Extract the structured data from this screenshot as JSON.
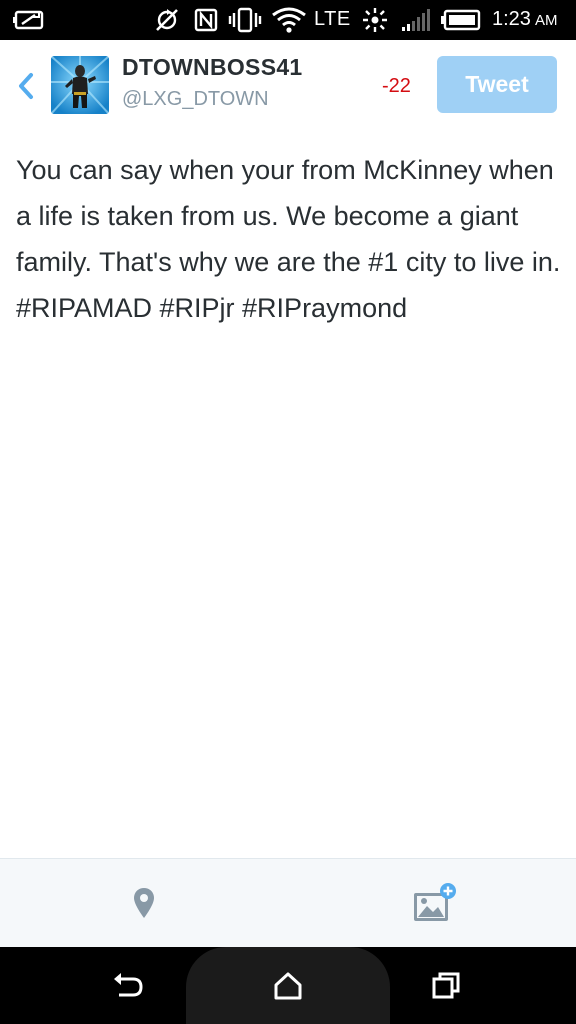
{
  "status_bar": {
    "network": "LTE",
    "time": "1:23",
    "ampm": "AM",
    "icons": [
      "battery-saver-icon",
      "sync-off-icon",
      "nfc-icon",
      "vibrate-icon",
      "wifi-icon",
      "signal-icon",
      "battery-icon"
    ]
  },
  "header": {
    "display_name": "DTOWNBOSS41",
    "handle": "@LXG_DTOWN",
    "char_count": "-22",
    "tweet_label": "Tweet"
  },
  "compose": {
    "text": "You can say when your from McKinney when a life is taken from us. We become a giant family. That's why we are the #1 city to live in. #RIPAMAD #RIPjr #RIPraymond"
  },
  "toolbar": {
    "icons": [
      "location-pin-icon",
      "add-photo-icon"
    ]
  },
  "nav_bar": {
    "icons": [
      "back-icon",
      "home-icon",
      "recent-apps-icon"
    ]
  },
  "colors": {
    "accent": "#55acee",
    "tweet_button_disabled": "#9fd0f5",
    "over_limit": "#d40d12",
    "text": "#292f33",
    "handle": "#8899a6"
  }
}
